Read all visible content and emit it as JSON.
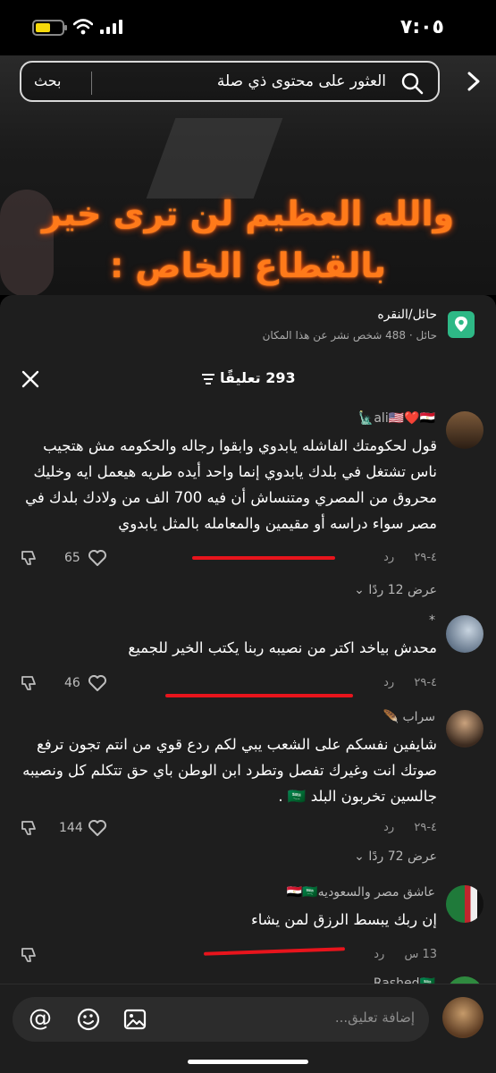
{
  "status_bar": {
    "time": "٧:٠٥"
  },
  "search": {
    "placeholder_text": "العثور على محتوى ذي صلة",
    "button_label": "بحث"
  },
  "video": {
    "caption_line1": "والله العظيم لن ترى خير",
    "caption_line2": "بالقطاع الخاص :"
  },
  "location": {
    "title": "حائل/النقره",
    "subtitle": "حائل · 488 شخص نشر عن هذا المكان"
  },
  "comments_header": {
    "count_label": "293 تعليقًا"
  },
  "comments": [
    {
      "user": "ali🇺🇸❤️🇪🇬🗽",
      "text": "قول لحكومتك الفاشله يابدوي وابقوا رجاله والحكومه مش هتجيب ناس تشتغل في بلدك يابدوي إنما واحد أيده طريه هيعمل ايه وخليك محروق من المصري ومتنساش أن فيه 700 الف من ولادك بلدك في مصر سواء دراسه أو مقيمين والمعامله بالمثل يابدوي",
      "date": "٤-٢٩",
      "reply_label": "رد",
      "likes": "65",
      "view_replies": "عرض 12 ردًا"
    },
    {
      "user": "*",
      "text": "محدش بياخد اكتر من نصيبه ربنا يكتب الخير للجميع",
      "date": "٤-٢٩",
      "reply_label": "رد",
      "likes": "46"
    },
    {
      "user": "سراب 🪶",
      "text": "شايفين نفسكم على الشعب يبي لكم ردع قوي من انتم تجون ترفع صوتك انت وغيرك تفصل وتطرد ابن الوطن باي حق تتكلم كل ونصيبه جالسين تخربون البلد 🇸🇦 .",
      "date": "٤-٢٩",
      "reply_label": "رد",
      "likes": "144",
      "view_replies": "عرض 72 ردًا"
    },
    {
      "user": "عاشق مصر والسعوديه🇪🇬🇸🇦",
      "text": "إن ربك يبسط الرزق لمن يشاء",
      "date": "13 س",
      "reply_label": "رد"
    },
    {
      "user": "Rashed🇸🇦"
    }
  ],
  "composer": {
    "placeholder": "إضافة تعليق..."
  },
  "colors": {
    "sheet_bg": "#1e1e1e",
    "caption": "#ff7a1a",
    "annotation_red": "#e8141c",
    "location_icon": "#2eb886"
  }
}
